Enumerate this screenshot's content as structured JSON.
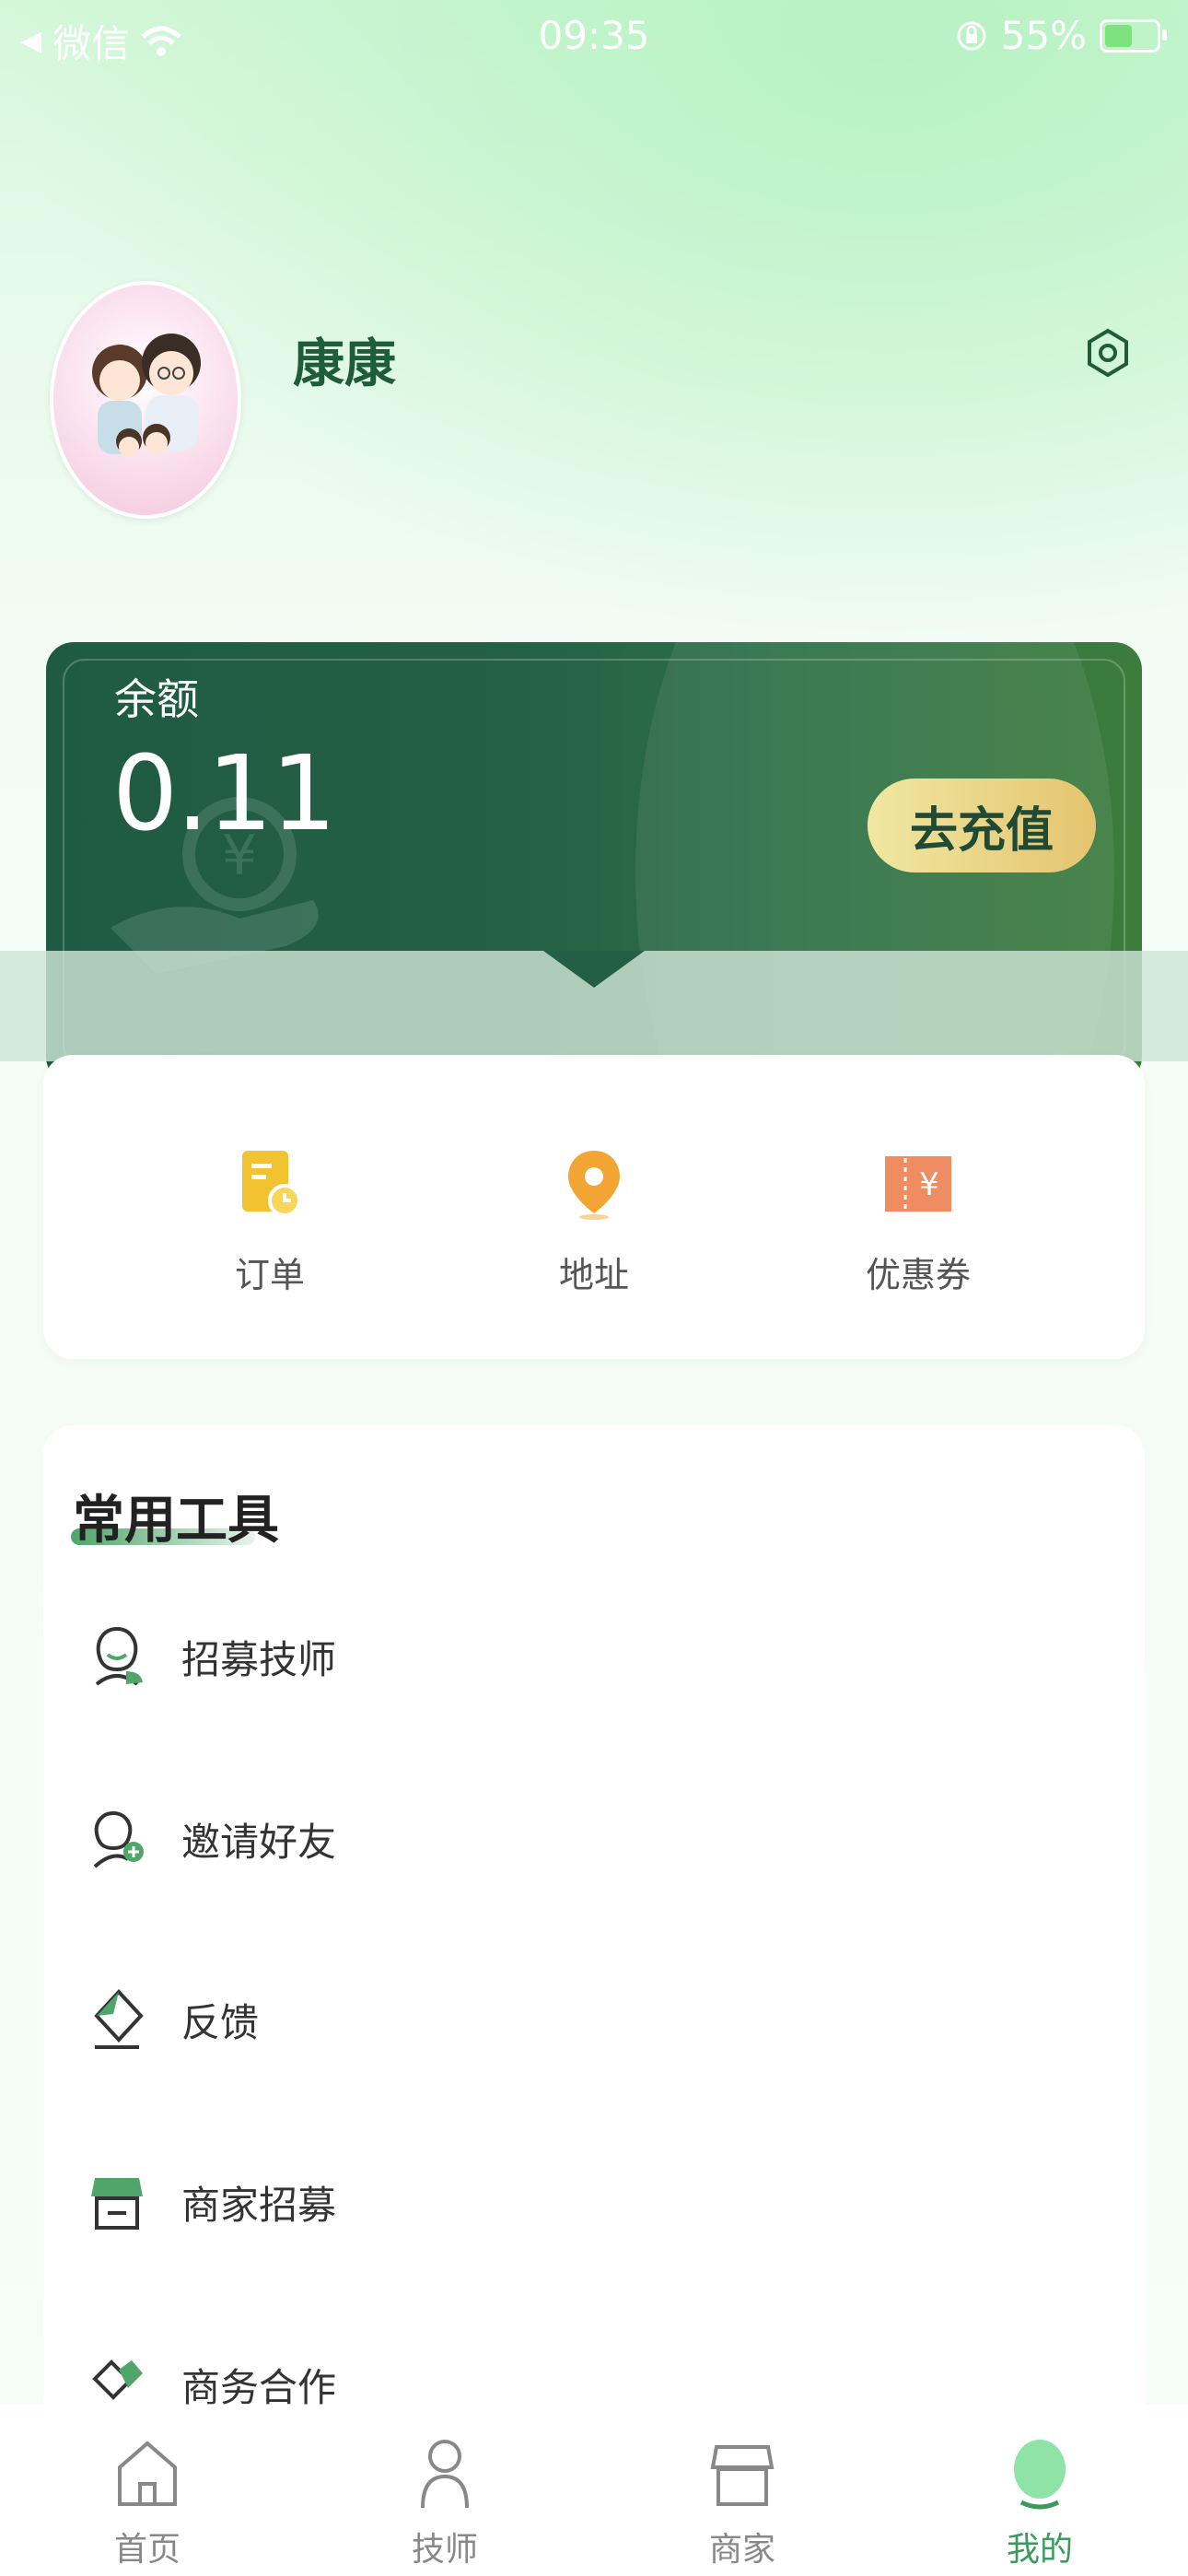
{
  "status_bar": {
    "carrier": "微信",
    "time": "09:35",
    "battery": "55%",
    "battery_level": 0.55
  },
  "profile": {
    "username": "康康"
  },
  "balance": {
    "label": "余额",
    "value": "0.11",
    "recharge_label": "去充值"
  },
  "quick_menu": [
    {
      "label": "订单",
      "icon": "order-icon",
      "color": "#f2c230"
    },
    {
      "label": "地址",
      "icon": "location-icon",
      "color": "#f2a533"
    },
    {
      "label": "优惠券",
      "icon": "coupon-icon",
      "color": "#f08c62"
    }
  ],
  "tools": {
    "title": "常用工具",
    "items": [
      {
        "label": "招募技师",
        "icon": "technician-recruit-icon"
      },
      {
        "label": "邀请好友",
        "icon": "invite-friend-icon"
      },
      {
        "label": "反馈",
        "icon": "feedback-icon"
      },
      {
        "label": "商家招募",
        "icon": "merchant-recruit-icon"
      },
      {
        "label": "商务合作",
        "icon": "business-cooperation-icon"
      }
    ]
  },
  "tab_bar": [
    {
      "label": "首页",
      "icon": "home-icon",
      "active": false
    },
    {
      "label": "技师",
      "icon": "technician-icon",
      "active": false
    },
    {
      "label": "商家",
      "icon": "shop-icon",
      "active": false
    },
    {
      "label": "我的",
      "icon": "profile-icon",
      "active": true
    }
  ],
  "colors": {
    "accent": "#3b9a5c",
    "card_dark": "#1f5b43",
    "username": "#1e5c3a"
  }
}
